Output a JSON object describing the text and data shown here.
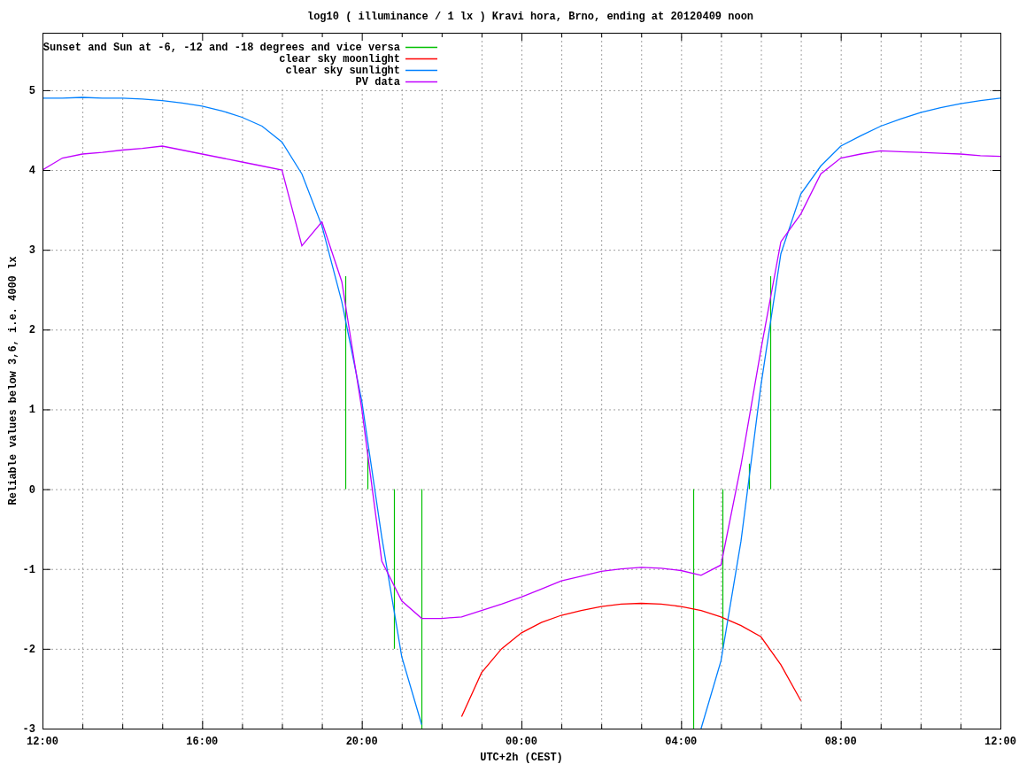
{
  "chart": {
    "chart_data": {
      "type": "line",
      "title": "log10 ( illuminance / 1 lx ) Kravi hora, Brno, ending at 20120409 noon",
      "xlabel": "UTC+2h (CEST)",
      "ylabel": "Reliable values below 3,6, i.e. 4000 lx",
      "categories": [
        "12:00",
        null,
        null,
        null,
        null,
        null,
        null,
        null,
        "16:00",
        null,
        null,
        null,
        null,
        null,
        null,
        null,
        "20:00",
        null,
        null,
        null,
        null,
        null,
        null,
        null,
        "00:00",
        null,
        null,
        null,
        null,
        null,
        null,
        null,
        "04:00",
        null,
        null,
        null,
        null,
        null,
        null,
        null,
        "08:00",
        null,
        null,
        null,
        null,
        null,
        null,
        null,
        "12:00"
      ],
      "series": [
        {
          "name": "clear sky moonlight",
          "color": "#ff0000",
          "values": [
            null,
            null,
            null,
            null,
            null,
            null,
            null,
            null,
            null,
            null,
            null,
            null,
            null,
            null,
            null,
            null,
            null,
            null,
            null,
            null,
            null,
            -2.85,
            -2.3,
            -2.0,
            -1.8,
            -1.67,
            -1.58,
            -1.52,
            -1.47,
            -1.44,
            -1.43,
            -1.44,
            -1.47,
            -1.52,
            -1.6,
            -1.71,
            -1.85,
            -2.2,
            -2.65,
            null,
            null,
            null,
            null,
            null,
            null,
            null,
            null,
            null,
            null
          ]
        },
        {
          "name": "clear sky sunlight",
          "color": "#0080ff",
          "values": [
            4.9,
            4.9,
            4.91,
            4.9,
            4.9,
            4.89,
            4.87,
            4.84,
            4.8,
            4.74,
            4.66,
            4.55,
            4.35,
            3.95,
            3.3,
            2.35,
            1.1,
            -0.6,
            -2.1,
            -2.95,
            null,
            null,
            null,
            null,
            null,
            null,
            null,
            null,
            null,
            null,
            null,
            null,
            null,
            -3,
            -2.15,
            -0.65,
            1.3,
            2.95,
            3.7,
            4.05,
            4.3,
            4.43,
            4.55,
            4.64,
            4.72,
            4.78,
            4.83,
            4.87,
            4.9
          ]
        },
        {
          "name": "PV data",
          "color": "#c000ff",
          "values": [
            4.0,
            4.15,
            4.2,
            4.22,
            4.25,
            4.27,
            4.3,
            4.25,
            4.2,
            4.15,
            4.1,
            4.05,
            4.0,
            3.05,
            3.35,
            2.6,
            1.0,
            -0.9,
            -1.4,
            -1.62,
            -1.62,
            -1.6,
            -1.52,
            -1.44,
            -1.35,
            -1.25,
            -1.15,
            -1.09,
            -1.03,
            -1.0,
            -0.98,
            -0.99,
            -1.02,
            -1.08,
            -0.95,
            0.3,
            1.75,
            3.1,
            3.45,
            3.95,
            4.15,
            4.2,
            4.24,
            4.23,
            4.22,
            4.21,
            4.2,
            4.18,
            4.17
          ]
        }
      ],
      "ylim": [
        -3,
        5.72
      ],
      "yticks": [
        -3,
        -2,
        -1,
        0,
        1,
        2,
        3,
        4,
        5
      ],
      "grid": true,
      "legend": {
        "items": [
          {
            "name": "Sunset and Sun at -6, -12 and -18 degrees and vice versa",
            "color": "#00c000"
          }
        ]
      }
    }
  }
}
